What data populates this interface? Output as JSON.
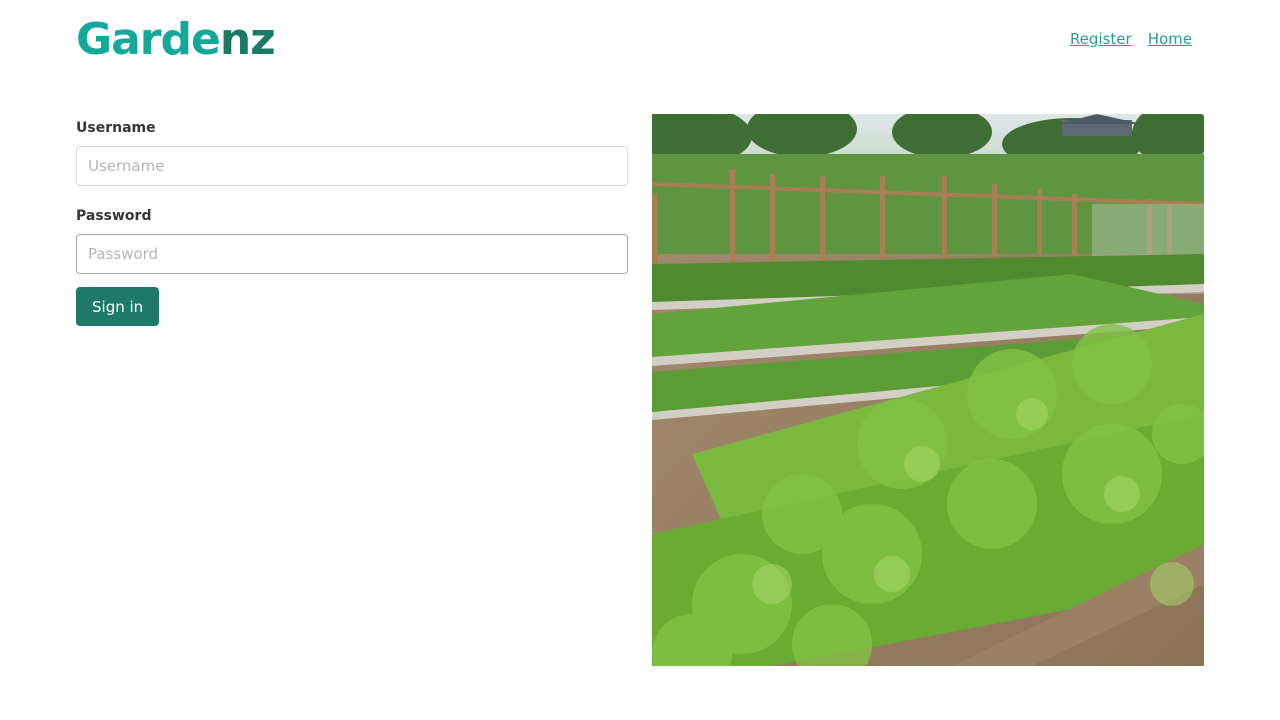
{
  "header": {
    "logo_part1": "Garde",
    "logo_part2": "nz",
    "nav": {
      "register": "Register",
      "home": "Home"
    }
  },
  "form": {
    "username_label": "Username",
    "username_placeholder": "Username",
    "password_label": "Password",
    "password_placeholder": "Password",
    "submit_label": "Sign in"
  },
  "colors": {
    "brand_teal": "#14a89a",
    "brand_dark": "#1a7a66",
    "button": "#1e7a67",
    "link": "#2a9d8f"
  }
}
